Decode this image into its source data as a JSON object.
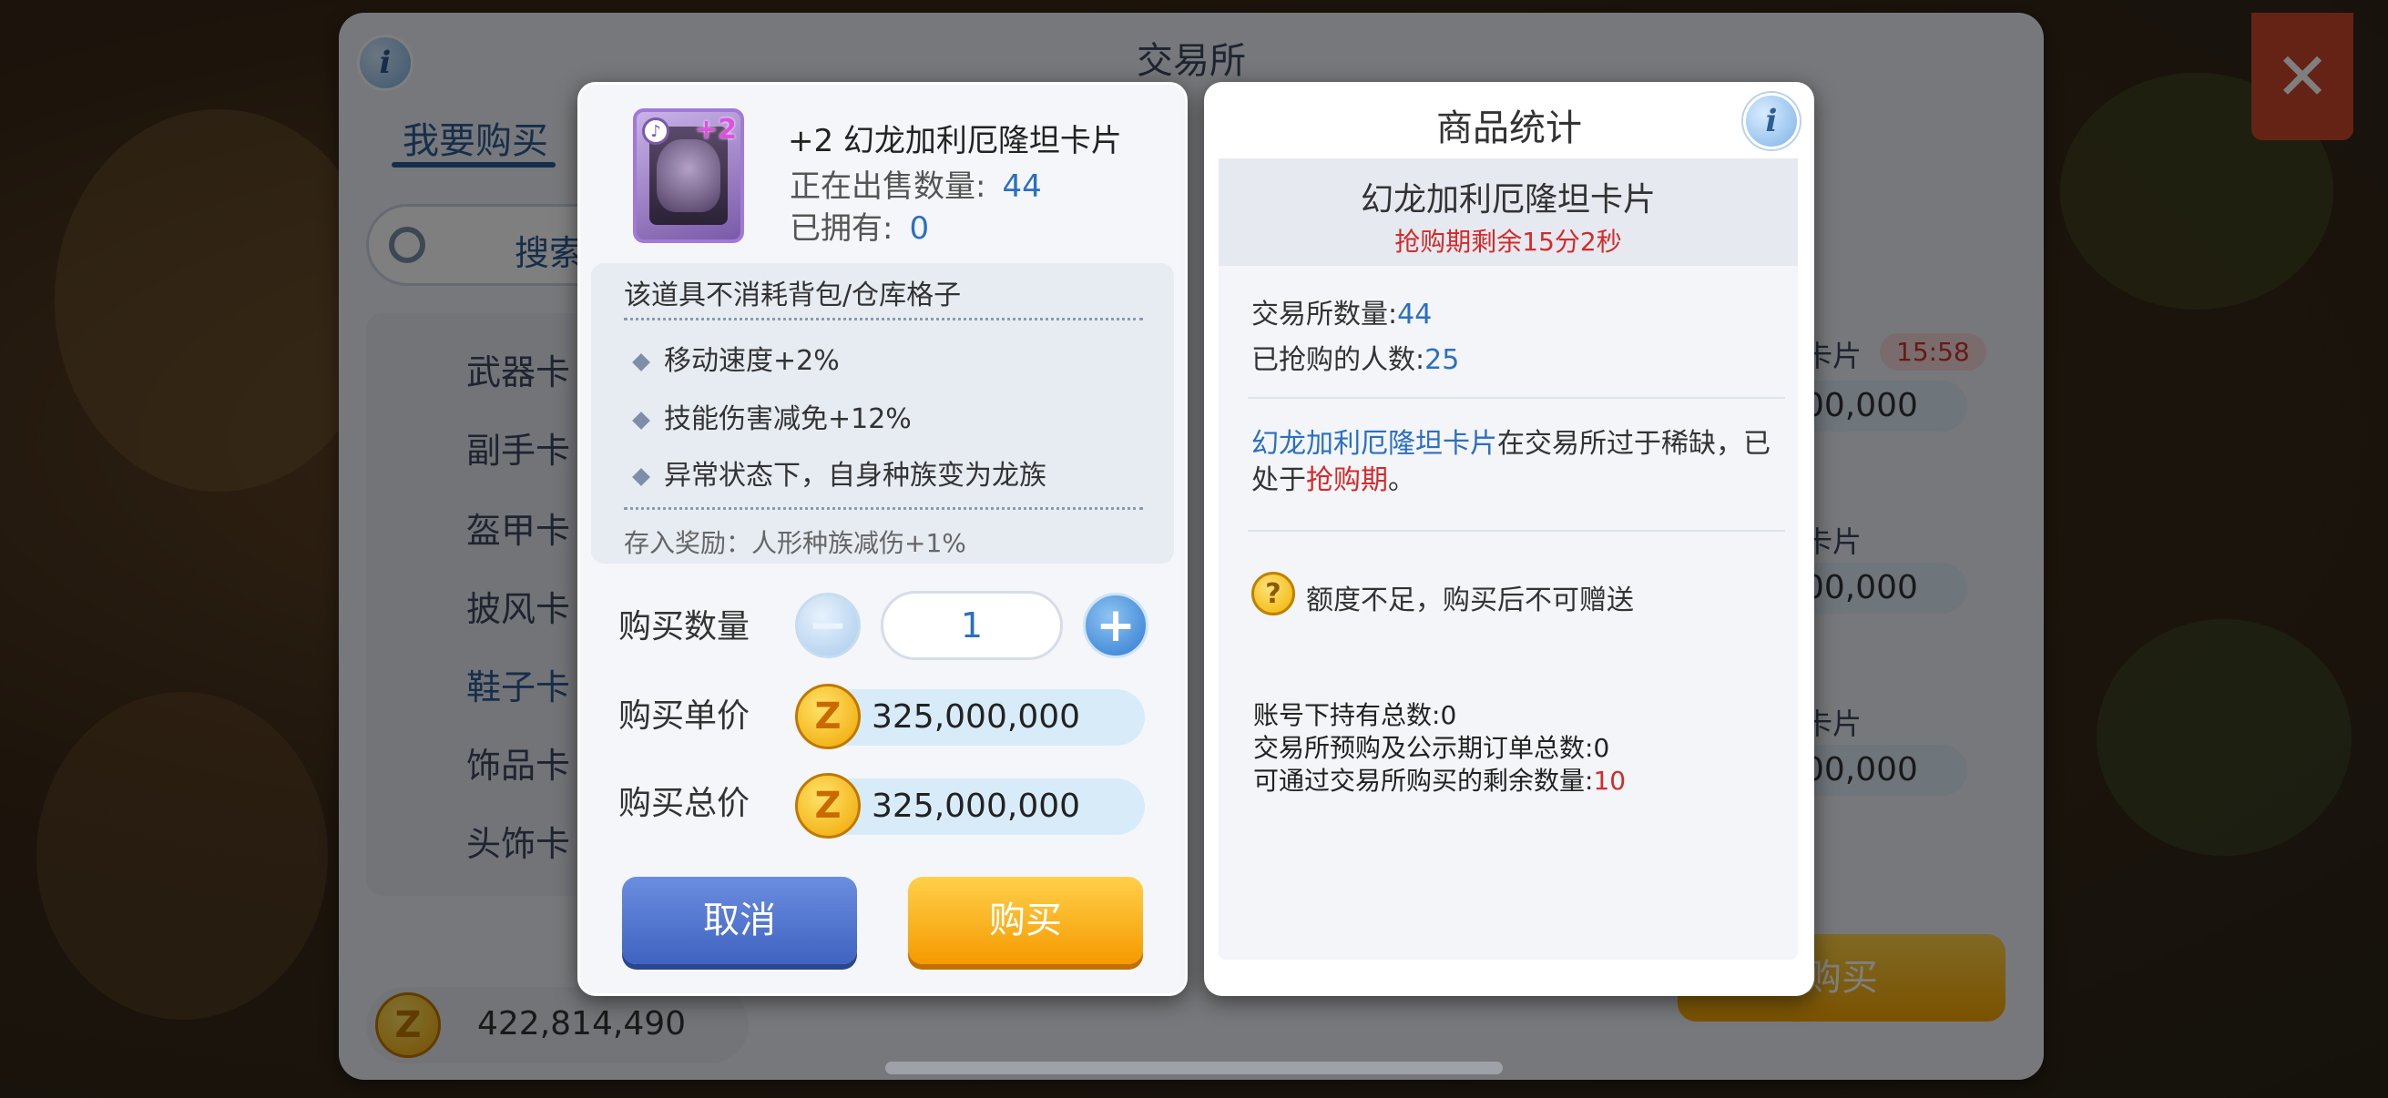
{
  "background": {
    "window_title": "交易所",
    "tab_active": "我要购买",
    "search_placeholder": "搜索",
    "categories": [
      "武器卡",
      "副手卡",
      "盔甲卡",
      "披风卡",
      "鞋子卡",
      "饰品卡",
      "头饰卡"
    ],
    "active_category": "鞋子卡",
    "balance": "422,814,490",
    "row_labels": [
      "卡片",
      "卡片",
      "卡片"
    ],
    "row_prices": [
      "00,000",
      "00,000",
      "00,000"
    ],
    "row_timer": "15:58",
    "buy_label": "购买"
  },
  "purchase": {
    "card_plus": "+2",
    "item_name": "+2 幻龙加利厄隆坦卡片",
    "on_sale_label": "正在出售数量:",
    "on_sale_value": "44",
    "owned_label": "已拥有:",
    "owned_value": "0",
    "desc_head": "该道具不消耗背包/仓库格子",
    "effects": [
      "移动速度+2%",
      "技能伤害减免+12%",
      "异常状态下，自身种族变为龙族"
    ],
    "deposit": "存入奖励：人形种族减伤+1%",
    "qty_label": "购买数量",
    "qty_value": "1",
    "unit_price_label": "购买单价",
    "unit_price": "325,000,000",
    "total_price_label": "购买总价",
    "total_price": "325,000,000",
    "cancel_label": "取消",
    "buy_label": "购买",
    "coin_symbol": "Z"
  },
  "stats": {
    "title": "商品统计",
    "item_name": "幻龙加利厄隆坦卡片",
    "countdown": "抢购期剩余15分2秒",
    "exchange_qty_label": "交易所数量:",
    "exchange_qty": "44",
    "buyers_label": "已抢购的人数:",
    "buyers": "25",
    "para_item": "幻龙加利厄隆坦卡片",
    "para_text1": "在交易所过于稀缺，已处于",
    "para_red": "抢购期",
    "para_text2": "。",
    "warning": "额度不足，购买后不可赠送",
    "account_total_label": "账号下持有总数:",
    "account_total": "0",
    "preorder_label": "交易所预购及公示期订单总数:",
    "preorder": "0",
    "remaining_label": "可通过交易所购买的剩余数量:",
    "remaining": "10"
  },
  "colors": {
    "accent_blue": "#2a6fc0",
    "alert_red": "#d42a2a",
    "buy_orange": "#f59a00",
    "cancel_blue": "#3f63c0"
  }
}
